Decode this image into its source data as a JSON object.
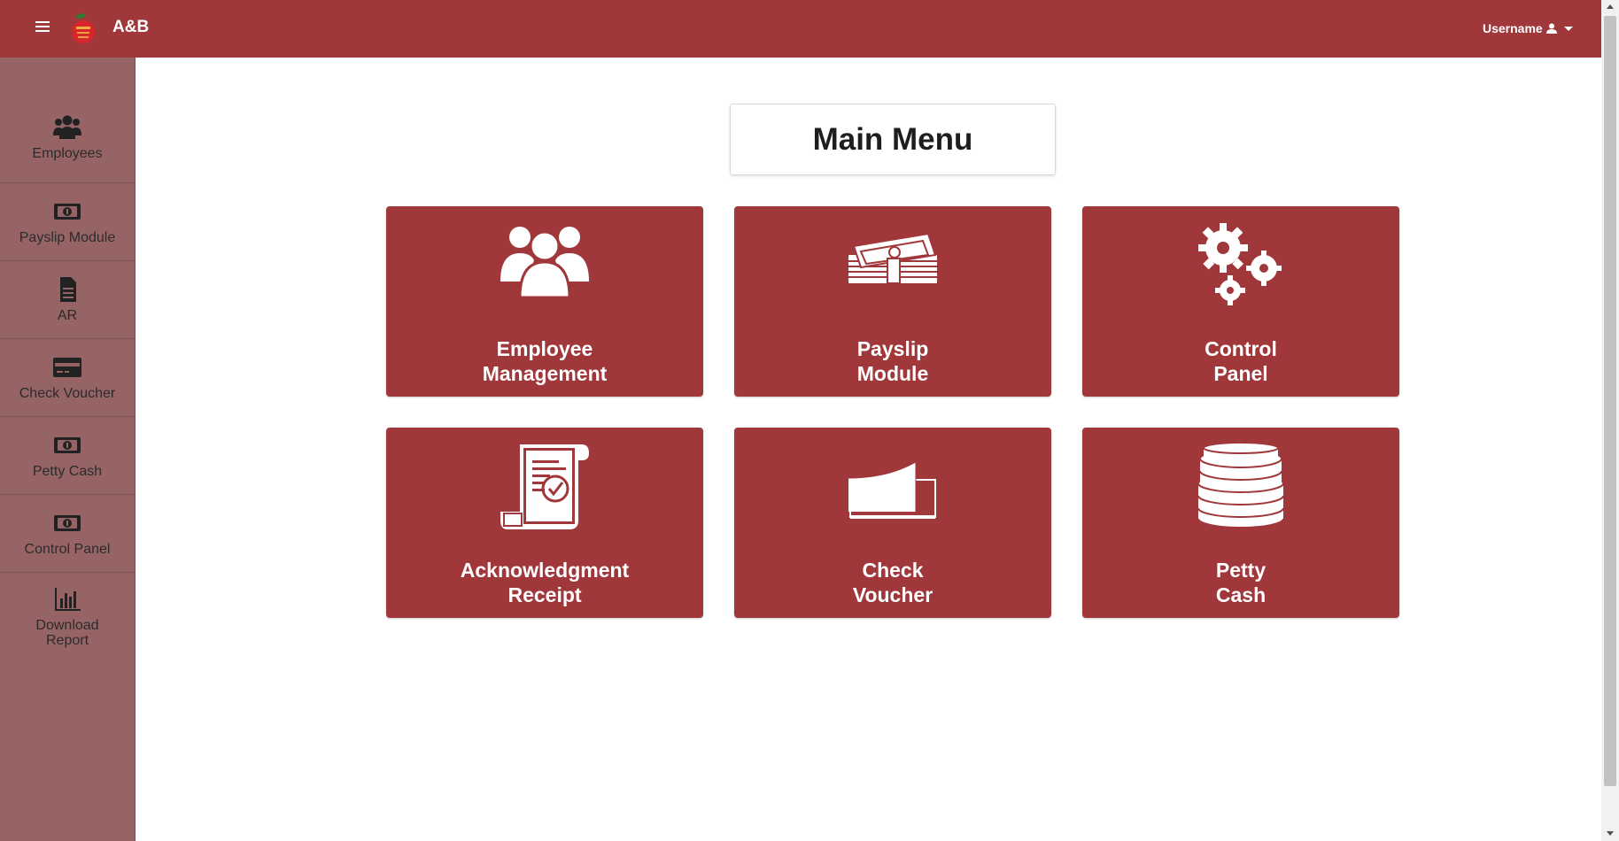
{
  "header": {
    "brand": "A&B",
    "user_label": "Username"
  },
  "sidebar": {
    "items": [
      {
        "label": "Employees",
        "icon": "users-icon"
      },
      {
        "label": "Payslip Module",
        "icon": "money-icon"
      },
      {
        "label": "AR",
        "icon": "file-icon"
      },
      {
        "label": "Check Voucher",
        "icon": "credit-card-icon"
      },
      {
        "label": "Petty Cash",
        "icon": "money-icon"
      },
      {
        "label": "Control Panel",
        "icon": "money-icon"
      },
      {
        "label": "Download\nReport",
        "icon": "bar-chart-icon"
      }
    ]
  },
  "main": {
    "title": "Main Menu",
    "tiles": [
      {
        "line1": "Employee",
        "line2": "Management",
        "icon": "users-group-icon"
      },
      {
        "line1": "Payslip",
        "line2": "Module",
        "icon": "cash-stack-icon"
      },
      {
        "line1": "Control",
        "line2": "Panel",
        "icon": "gears-icon"
      },
      {
        "line1": "Acknowledgment",
        "line2": "Receipt",
        "icon": "receipt-scroll-icon"
      },
      {
        "line1": "Check",
        "line2": "Voucher",
        "icon": "check-paper-icon"
      },
      {
        "line1": "Petty",
        "line2": "Cash",
        "icon": "coin-stack-icon"
      }
    ]
  },
  "colors": {
    "primary": "#a0373a",
    "sidebar": "#976466"
  }
}
